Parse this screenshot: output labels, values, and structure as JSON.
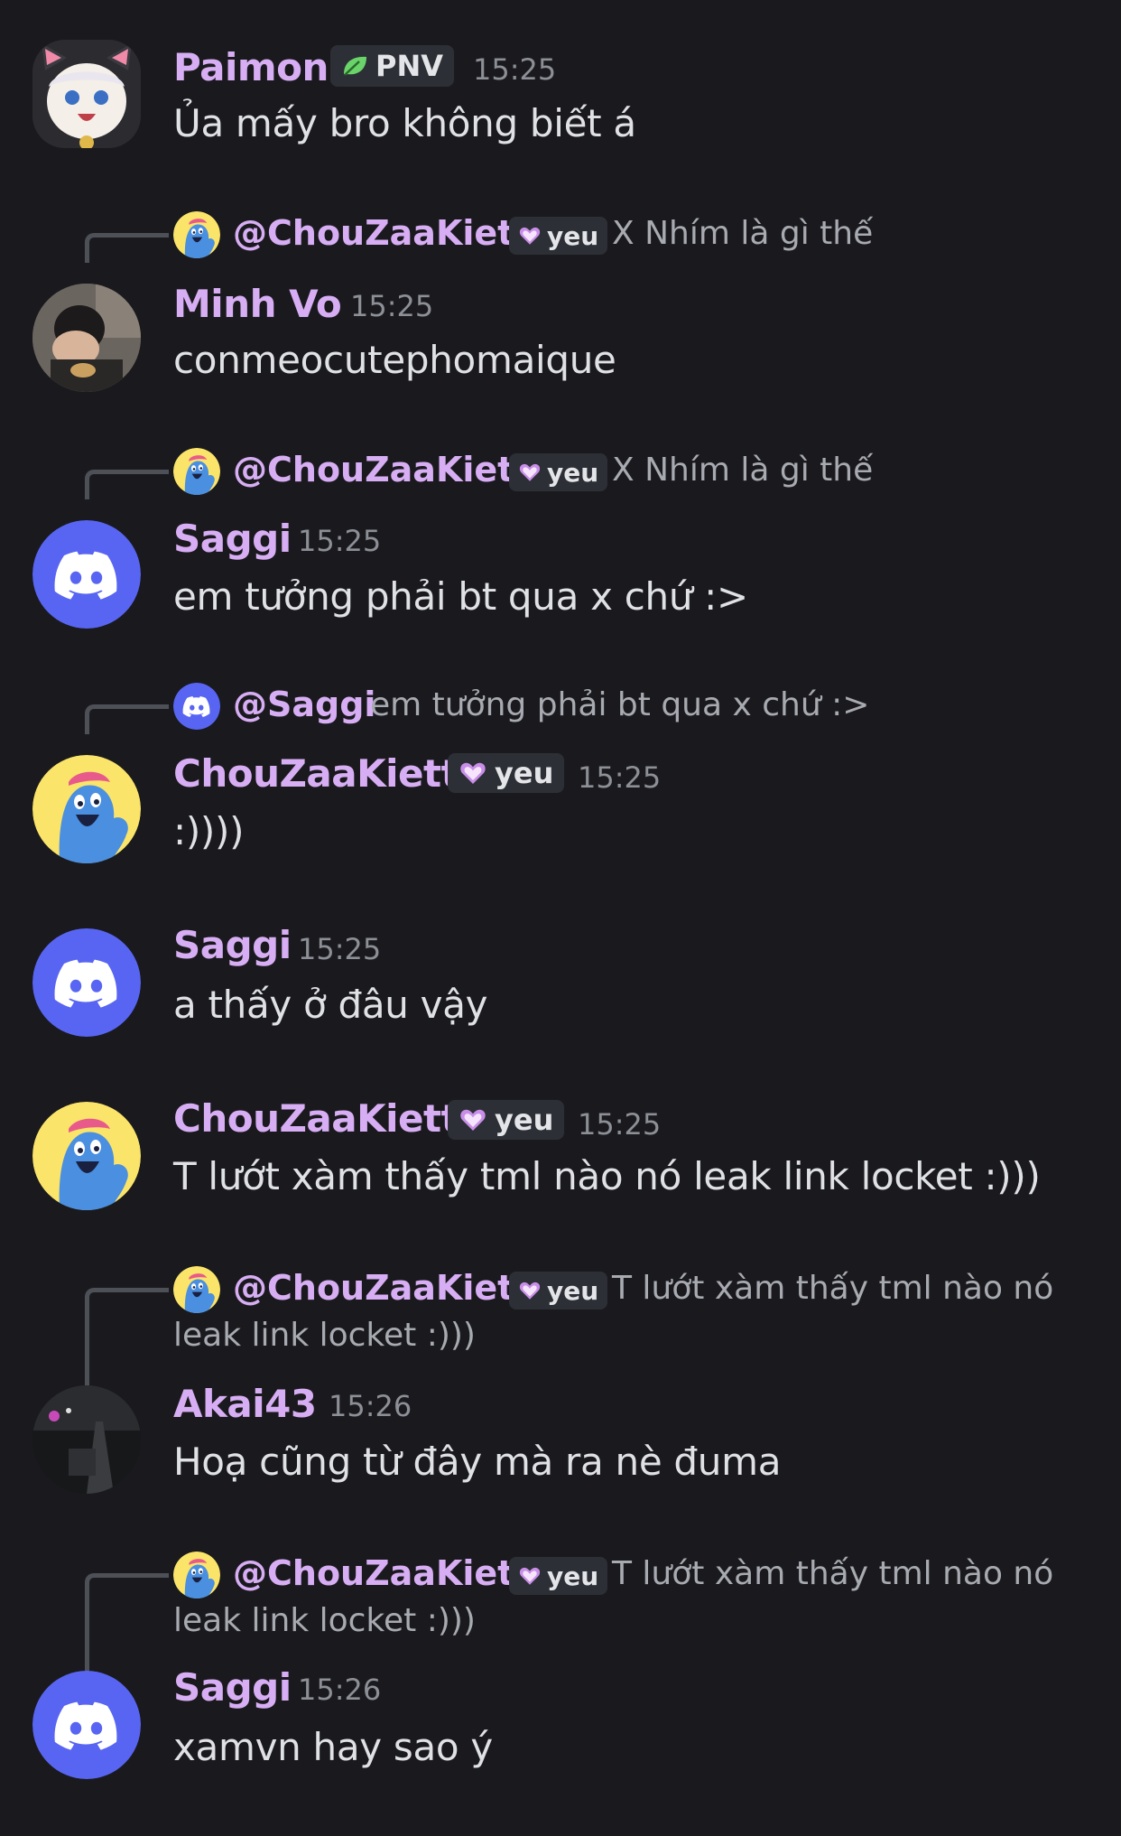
{
  "colors": {
    "background": "#1a1a1e",
    "username": "#d7aef3",
    "discord_blurple": "#5865f2",
    "timestamp": "#8c8f96"
  },
  "messages": [
    {
      "author": "Paimon",
      "tag": "PNV",
      "tag_icon": "leaf-icon",
      "time": "15:25",
      "text": "Ủa mấy bro không biết á",
      "avatar": "paimon-avatar"
    },
    {
      "reply": {
        "name": "@ChouZaaKiett",
        "tag": "yeu",
        "text": "X Nhím là gì thế"
      },
      "author": "Minh Vo",
      "time": "15:25",
      "text": "conmeocutephomaique",
      "avatar": "photo-avatar"
    },
    {
      "reply": {
        "name": "@ChouZaaKiett",
        "tag": "yeu",
        "text": "X Nhím là gì thế"
      },
      "author": "Saggi",
      "time": "15:25",
      "text": "em tưởng phải bt qua x chứ :>",
      "avatar": "discord-avatar"
    },
    {
      "reply": {
        "name": "@Saggi",
        "text": "em tưởng phải bt qua x chứ :>"
      },
      "author": "ChouZaaKiett",
      "tag": "yeu",
      "time": "15:25",
      "text": ":))))",
      "avatar": "blue-creature-avatar"
    },
    {
      "author": "Saggi",
      "time": "15:25",
      "text": "a thấy ở đâu vậy",
      "avatar": "discord-avatar"
    },
    {
      "author": "ChouZaaKiett",
      "tag": "yeu",
      "time": "15:25",
      "text": "T lướt xàm thấy tml nào nó leak link locket :)))",
      "avatar": "blue-creature-avatar"
    },
    {
      "reply": {
        "name": "@ChouZaaKiett",
        "tag": "yeu",
        "text": "T lướt xàm thấy tml nào nó",
        "text2": "leak link locket :)))"
      },
      "author": "Akai43",
      "time": "15:26",
      "text": "Hoạ cũng từ đây mà ra nè đuma",
      "avatar": "night-photo-avatar"
    },
    {
      "reply": {
        "name": "@ChouZaaKiett",
        "tag": "yeu",
        "text": "T lướt xàm thấy tml nào nó",
        "text2": "leak link locket :)))"
      },
      "author": "Saggi",
      "time": "15:26",
      "text": "xamvn hay sao ý",
      "avatar": "discord-avatar"
    }
  ]
}
